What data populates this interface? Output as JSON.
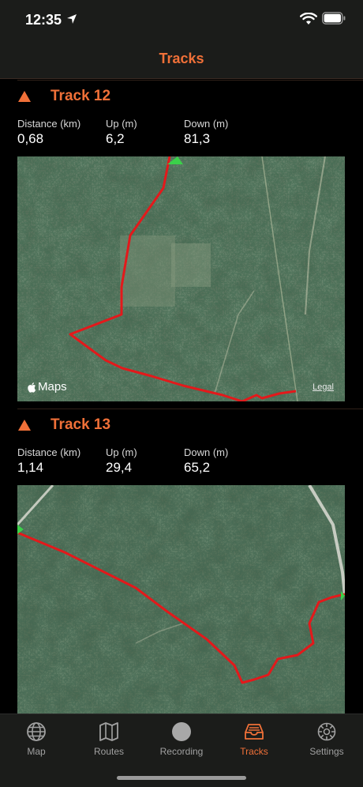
{
  "status_bar": {
    "time": "12:35"
  },
  "nav": {
    "title": "Tracks"
  },
  "tracks": [
    {
      "name": "Track 12",
      "stats": [
        {
          "label": "Distance (km)",
          "value": "0,68"
        },
        {
          "label": "Up (m)",
          "value": "6,2"
        },
        {
          "label": "Down (m)",
          "value": "81,3"
        }
      ],
      "map_logo": "Maps",
      "map_legal": "Legal"
    },
    {
      "name": "Track 13",
      "stats": [
        {
          "label": "Distance (km)",
          "value": "1,14"
        },
        {
          "label": "Up (m)",
          "value": "29,4"
        },
        {
          "label": "Down (m)",
          "value": "65,2"
        }
      ]
    }
  ],
  "tab_bar": {
    "items": [
      {
        "label": "Map",
        "icon": "globe-icon"
      },
      {
        "label": "Routes",
        "icon": "map-icon"
      },
      {
        "label": "Recording",
        "icon": "record-icon"
      },
      {
        "label": "Tracks",
        "icon": "tray-icon"
      },
      {
        "label": "Settings",
        "icon": "gear-icon"
      }
    ],
    "active": "Tracks"
  },
  "colors": {
    "accent": "#f07038",
    "track_line": "#e3191b",
    "start_marker": "#3bd14a"
  }
}
